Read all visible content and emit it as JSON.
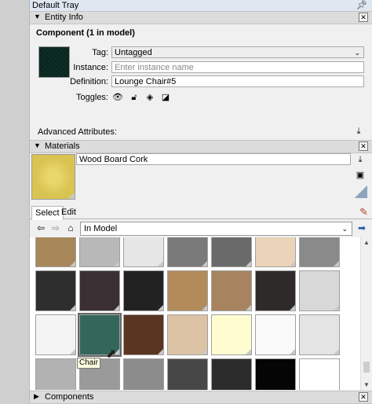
{
  "tray": {
    "title": "Default Tray",
    "pin_icon": "pushpin-icon"
  },
  "entity_info": {
    "header": "Entity Info",
    "component_title": "Component (1 in model)",
    "tag_label": "Tag:",
    "tag_value": "Untagged",
    "instance_label": "Instance:",
    "instance_placeholder": "Enter instance name",
    "definition_label": "Definition:",
    "definition_value": "Lounge Chair#5",
    "toggles_label": "Toggles:",
    "advanced_label": "Advanced Attributes:",
    "toggle_icons": [
      "visibility-eye-icon",
      "lock-icon",
      "receive-shadows-icon",
      "cast-shadows-icon"
    ]
  },
  "materials": {
    "header": "Materials",
    "material_name": "Wood Board Cork",
    "tabs": [
      "Select",
      "Edit"
    ],
    "active_tab": "Select",
    "collection": "In Model",
    "tooltip": "Chair"
  },
  "components": {
    "header": "Components"
  },
  "colors": {
    "swatches": [
      "#a8875a",
      "#b8b8b8",
      "#e6e6e6",
      "#7a7a7a",
      "#6a6a6a",
      "#ead3b8",
      "#8a8a8a",
      "#2e2e2e",
      "#3a2f33",
      "#222222",
      "#b38b5b",
      "#a7845f",
      "#2e2a29",
      "#d8d8d8",
      "#f4f4f4",
      "#35665c",
      "#5a3521",
      "#dcc3a5",
      "#fffdd0",
      "#fafafa",
      "#e4e4e4",
      "#b2b2b2",
      "#9a9a9a",
      "#8c8c8c",
      "#474747",
      "#2c2c2c",
      "#050505",
      "#ffffff"
    ]
  }
}
